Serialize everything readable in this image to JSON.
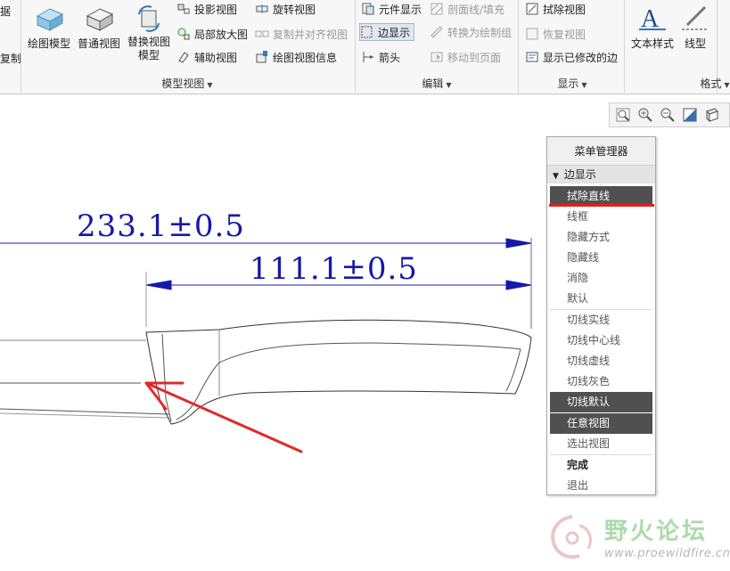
{
  "ribbon": {
    "left_partial": {
      "top": "据",
      "bottom": "复制"
    },
    "groups": {
      "model_views": {
        "label": "模型视图",
        "big": [
          {
            "label": "绘图模型"
          },
          {
            "label": "普通视图"
          },
          {
            "label": "替换视图\n模型"
          }
        ],
        "small": [
          {
            "label": "投影视图",
            "disabled": false
          },
          {
            "label": "旋转视图",
            "disabled": false
          },
          {
            "label": "局部放大图",
            "disabled": false
          },
          {
            "label": "复制并对齐视图",
            "disabled": true
          },
          {
            "label": "辅助视图",
            "disabled": false
          },
          {
            "label": "绘图视图信息",
            "disabled": false
          }
        ]
      },
      "edit": {
        "label": "编辑",
        "small": [
          {
            "label": "元件显示",
            "disabled": false
          },
          {
            "label": "剖面线/填充",
            "disabled": true
          },
          {
            "label": "边显示",
            "disabled": false,
            "active": true
          },
          {
            "label": "转换为绘制组",
            "disabled": true
          },
          {
            "label": "箭头",
            "disabled": false
          },
          {
            "label": "移动到页面",
            "disabled": true
          }
        ]
      },
      "display": {
        "label": "显示",
        "small": [
          {
            "label": "拭除视图",
            "disabled": false
          },
          {
            "label": "恢复视图",
            "disabled": true
          },
          {
            "label": "显示已修改的边",
            "disabled": false
          }
        ]
      },
      "format": {
        "label": "格式",
        "big": [
          {
            "label": "文本样式"
          },
          {
            "label": "线型"
          }
        ]
      }
    }
  },
  "view_toolbar": {
    "icons": [
      "refit-icon",
      "zoom-in-icon",
      "zoom-out-icon",
      "repaint-icon",
      "display-style-icon"
    ]
  },
  "drawing": {
    "dim_overall": "233.1±0.5",
    "dim_handle": "111.1±0.5",
    "dim_color": "#1818a8",
    "arrow_color": "#e02a2a"
  },
  "menu_manager": {
    "title": "菜单管理器",
    "submenu": "边显示",
    "items": [
      {
        "label": "拭除直线",
        "selected": true,
        "bold": false
      },
      {
        "label": "线框",
        "selected": false,
        "bold": false
      },
      {
        "label": "隐藏方式",
        "selected": false,
        "bold": false
      },
      {
        "label": "隐藏线",
        "selected": false,
        "bold": false
      },
      {
        "label": "消隐",
        "selected": false,
        "bold": false
      },
      {
        "label": "默认",
        "selected": false,
        "bold": false
      },
      {
        "label": "切线实线",
        "selected": false,
        "bold": false
      },
      {
        "label": "切线中心线",
        "selected": false,
        "bold": false
      },
      {
        "label": "切线虚线",
        "selected": false,
        "bold": false
      },
      {
        "label": "切线灰色",
        "selected": false,
        "bold": false
      },
      {
        "label": "切线默认",
        "selected": true,
        "bold": false
      },
      {
        "label": "任意视图",
        "selected": true,
        "bold": false
      },
      {
        "label": "选出视图",
        "selected": false,
        "bold": false
      },
      {
        "label": "完成",
        "selected": false,
        "bold": true
      },
      {
        "label": "退出",
        "selected": false,
        "bold": false
      }
    ]
  },
  "watermark": {
    "text": "野火论坛",
    "url": "www.proewildfire.cn"
  }
}
